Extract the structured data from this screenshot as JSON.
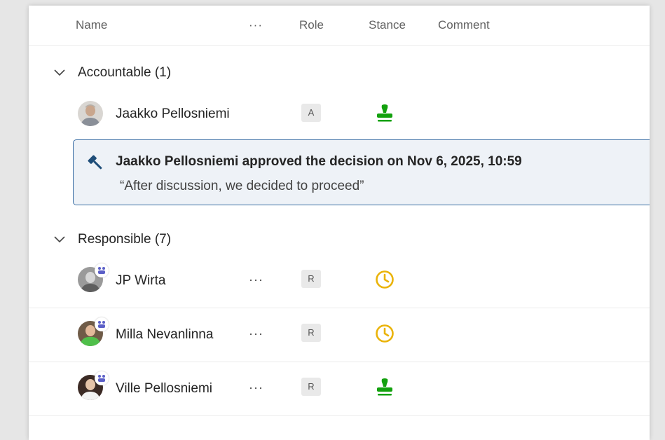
{
  "header": {
    "name_label": "Name",
    "more_label": "···",
    "role_label": "Role",
    "stance_label": "Stance",
    "comment_label": "Comment"
  },
  "sections": [
    {
      "title": "Accountable (1)",
      "people": [
        {
          "name": "Jaakko Pellosniemi",
          "role": "A",
          "stance": "approved"
        }
      ],
      "callout": {
        "main": "Jaakko Pellosniemi approved the decision on Nov 6, 2025, 10:59",
        "comment": "“After discussion, we decided to proceed”",
        "icon": "gavel-icon"
      }
    },
    {
      "title": "Responsible (7)",
      "people": [
        {
          "name": "JP Wirta",
          "more": "···",
          "role": "R",
          "stance": "pending"
        },
        {
          "name": "Milla Nevanlinna",
          "more": "···",
          "role": "R",
          "stance": "pending"
        },
        {
          "name": "Ville Pellosniemi",
          "more": "···",
          "role": "R",
          "stance": "approved"
        }
      ]
    }
  ],
  "colors": {
    "approved": "#13a10e",
    "pending": "#eab308",
    "callout_border": "#3a6ea5",
    "gavel": "#1f4e79",
    "teams": "#5b5fc7"
  }
}
